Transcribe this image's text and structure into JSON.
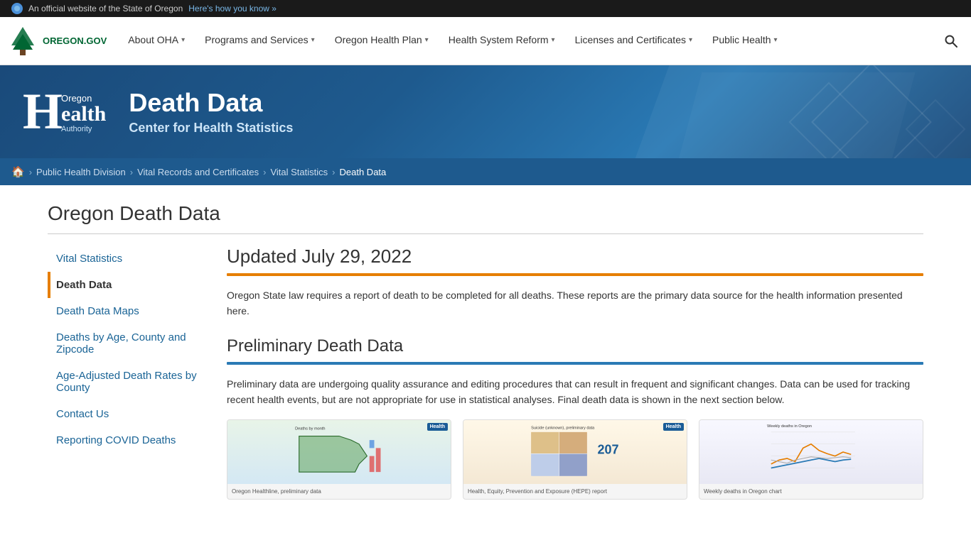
{
  "topbar": {
    "text": "An official website of the State of Oregon",
    "link": "Here's how you know »"
  },
  "nav": {
    "logo": "OREGON.GOV",
    "items": [
      {
        "label": "About OHA",
        "id": "about-oha"
      },
      {
        "label": "Programs and Services",
        "id": "programs-services"
      },
      {
        "label": "Oregon Health Plan",
        "id": "oregon-health-plan"
      },
      {
        "label": "Health System Reform",
        "id": "health-system-reform"
      },
      {
        "label": "Licenses and Certificates",
        "id": "licenses-certificates"
      },
      {
        "label": "Public Health",
        "id": "public-health"
      }
    ]
  },
  "hero": {
    "logo_letter": "H",
    "logo_top": "Oregon",
    "logo_bottom": "ealth",
    "logo_authority": "Authority",
    "title": "Death Data",
    "subtitle": "Center for Health Statistics"
  },
  "breadcrumb": {
    "home": "🏠",
    "items": [
      {
        "label": "Public Health Division",
        "href": "#"
      },
      {
        "label": "Vital Records and Certificates",
        "href": "#"
      },
      {
        "label": "Vital Statistics",
        "href": "#"
      },
      {
        "label": "Death Data",
        "current": true
      }
    ]
  },
  "page": {
    "title": "Oregon Death Data"
  },
  "sidebar": {
    "items": [
      {
        "label": "Vital Statistics",
        "id": "vital-statistics",
        "active": false
      },
      {
        "label": "Death Data",
        "id": "death-data",
        "active": true
      },
      {
        "label": "Death Data Maps",
        "id": "death-data-maps",
        "active": false
      },
      {
        "label": "Deaths by Age, County and Zipcode",
        "id": "deaths-by-age",
        "active": false
      },
      {
        "label": "Age-Adjusted Death Rates by County",
        "id": "age-adjusted",
        "active": false
      },
      {
        "label": "Contact Us",
        "id": "contact-us",
        "active": false
      },
      {
        "label": "Reporting COVID Deaths",
        "id": "covid-deaths",
        "active": false
      }
    ]
  },
  "article": {
    "section1": {
      "heading": "Updated July 29, 2022",
      "body": "Oregon State law requires a report of death to be completed for all deaths. These reports are the primary data source for the health information presented here."
    },
    "section2": {
      "heading": "Preliminary Death Data",
      "body": "Preliminary data are undergoing quality assurance and editing procedures that can result in frequent and significant changes. Data can be used for tracking recent health events, but are not appropriate for use in statistical analyses. Final death data is shown in the next section below."
    }
  }
}
